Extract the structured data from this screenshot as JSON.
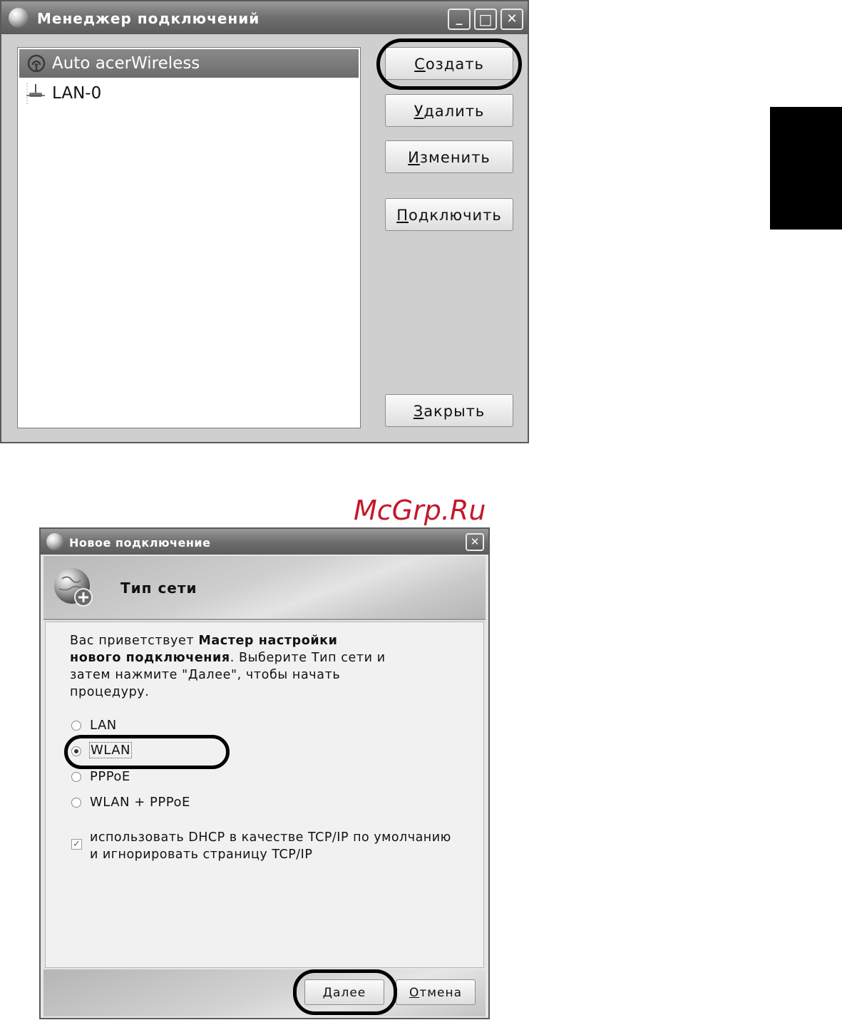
{
  "connection_manager": {
    "title": "Менеджер подключений",
    "window_controls": {
      "minimize": "_",
      "maximize": "□",
      "close": "✕"
    },
    "connections": [
      {
        "name": "Auto acerWireless",
        "icon": "wireless-icon",
        "selected": true
      },
      {
        "name": "LAN-0",
        "icon": "lan-icon",
        "selected": false
      }
    ],
    "buttons": {
      "create": {
        "first": "С",
        "rest": "оздать"
      },
      "delete": {
        "first": "У",
        "rest": "далить"
      },
      "edit": {
        "first": "И",
        "rest": "зменить"
      },
      "connect": {
        "first": "П",
        "rest": "одключить"
      },
      "close": {
        "first": "З",
        "rest": "акрыть"
      }
    }
  },
  "watermark": "McGrp.Ru",
  "new_connection": {
    "title": "Новое подключение",
    "close_glyph": "✕",
    "header_title": "Тип сети",
    "intro": {
      "part1": "Вас приветствует ",
      "bold1": "Мастер настройки",
      "bold2": "нового подключения",
      "part2": ". Выберите Тип сети и",
      "line3": "затем нажмите \"Далее\", чтобы начать",
      "line4": "процедуру."
    },
    "network_types": [
      {
        "label": "LAN",
        "checked": false
      },
      {
        "label": "WLAN",
        "checked": true
      },
      {
        "label": "PPPoE",
        "checked": false
      },
      {
        "label": "WLAN + PPPoE",
        "checked": false
      }
    ],
    "dhcp_checkbox": {
      "checked": true,
      "line1": "использовать DHCP в качестве TCP/IP по умолчанию",
      "line2": "и игнорировать страницу TCP/IP"
    },
    "buttons": {
      "next": {
        "first": "Д",
        "rest": "алее"
      },
      "cancel": {
        "first": "О",
        "rest": "тмена"
      }
    }
  },
  "colors": {
    "highlight": "#000000",
    "selection": "#7a7a7a",
    "watermark": "#c4182a"
  }
}
